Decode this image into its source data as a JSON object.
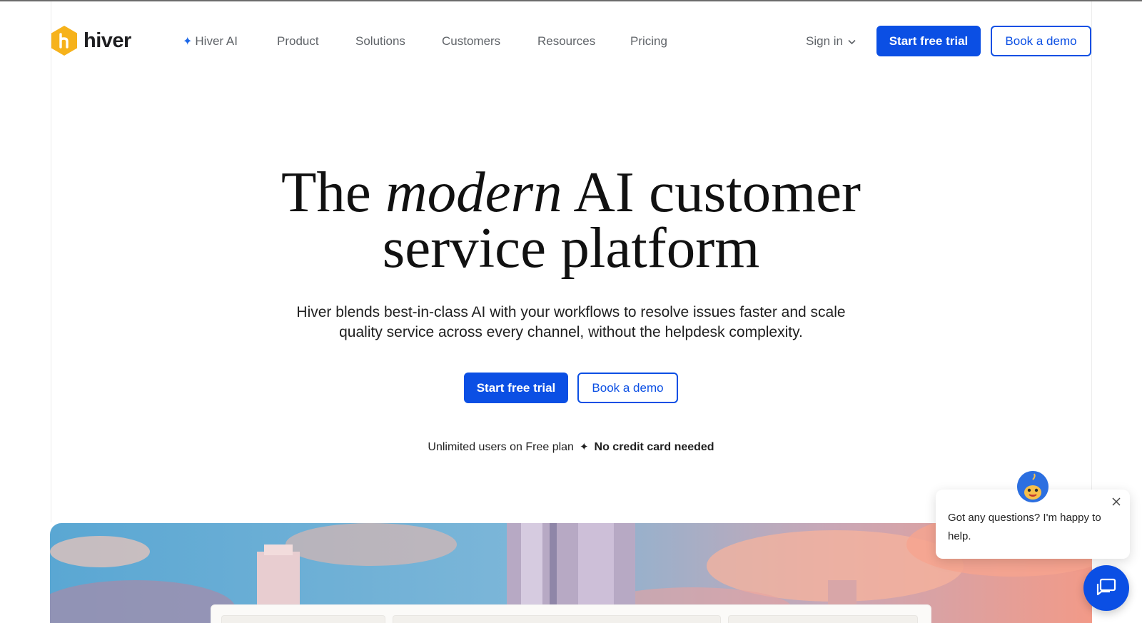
{
  "brand": {
    "name": "hiver",
    "accent": "#0b4fe4",
    "logo_color": "#f6b21b"
  },
  "nav": {
    "items": [
      {
        "label": "Hiver AI",
        "icon": "sparkle-icon"
      },
      {
        "label": "Product"
      },
      {
        "label": "Solutions"
      },
      {
        "label": "Customers"
      },
      {
        "label": "Resources"
      },
      {
        "label": "Pricing"
      }
    ],
    "signin_label": "Sign in",
    "start_trial_label": "Start free trial",
    "book_demo_label": "Book a demo"
  },
  "hero": {
    "title_before": "The ",
    "title_emphasis": "modern",
    "title_after_line1": " AI customer",
    "title_line2": "service platform",
    "subtitle": "Hiver blends best-in-class AI with your workflows to resolve issues faster and scale quality service across every channel, without the helpdesk complexity.",
    "cta_primary": "Start free trial",
    "cta_secondary": "Book a demo",
    "note_plain": "Unlimited users on Free plan",
    "note_separator": "✦",
    "note_bold": "No credit card needed"
  },
  "chat": {
    "message": "Got any questions? I'm happy to help.",
    "close_icon": "close-icon",
    "launcher_icon": "chat-icon"
  }
}
